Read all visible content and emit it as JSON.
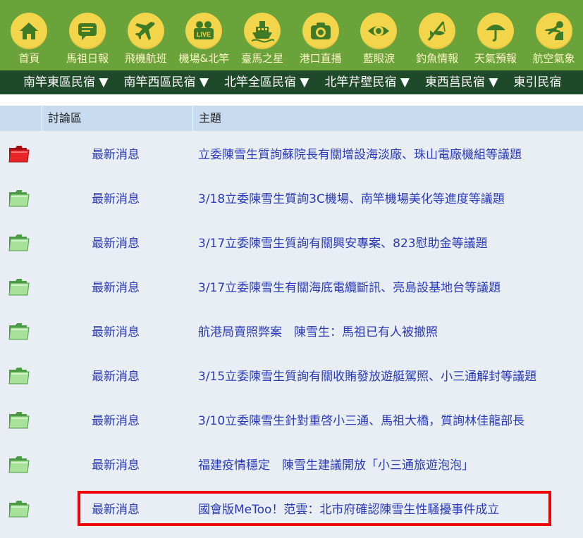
{
  "top_nav": [
    {
      "label": "首頁",
      "icon": "home-icon"
    },
    {
      "label": "馬祖日報",
      "icon": "speech-bubble-icon"
    },
    {
      "label": "飛機航班",
      "icon": "airplane-icon"
    },
    {
      "label": "機場&北竿",
      "icon": "live-camera-icon"
    },
    {
      "label": "臺馬之星",
      "icon": "ship-icon"
    },
    {
      "label": "港口直播",
      "icon": "camera-icon"
    },
    {
      "label": "藍眼淚",
      "icon": "eye-icon"
    },
    {
      "label": "釣魚情報",
      "icon": "fishing-icon"
    },
    {
      "label": "天氣預報",
      "icon": "umbrella-icon"
    },
    {
      "label": "航空氣象",
      "icon": "plane-weather-icon"
    }
  ],
  "sub_nav": [
    "南竿東區民宿 ▼",
    "南竿西區民宿 ▼",
    "北竿全區民宿 ▼",
    "北竿芹壁民宿 ▼",
    "東西莒民宿 ▼",
    "東引民宿"
  ],
  "table": {
    "headers": {
      "forum": "討論區",
      "topic": "主題"
    },
    "rows": [
      {
        "folder": "red",
        "forum": "最新消息",
        "topic": "立委陳雪生質詢蘇院長有關增設海淡廠、珠山電廠機組等議題"
      },
      {
        "folder": "green",
        "forum": "最新消息",
        "topic": "3/18立委陳雪生質詢3C機場、南竿機場美化等進度等議題"
      },
      {
        "folder": "green",
        "forum": "最新消息",
        "topic": "3/17立委陳雪生質詢有關興安專案、823慰助金等議題"
      },
      {
        "folder": "green",
        "forum": "最新消息",
        "topic": "3/17立委陳雪生有關海底電纜斷訊、亮島設基地台等議題"
      },
      {
        "folder": "green",
        "forum": "最新消息",
        "topic": "航港局賣照弊案　陳雪生：馬祖已有人被撤照"
      },
      {
        "folder": "green",
        "forum": "最新消息",
        "topic": "3/15立委陳雪生質詢有關收賄發放遊艇駕照、小三通解封等議題"
      },
      {
        "folder": "green",
        "forum": "最新消息",
        "topic": "3/10立委陳雪生針對重啓小三通、馬祖大橋，質詢林佳龍部長"
      },
      {
        "folder": "green",
        "forum": "最新消息",
        "topic": "福建疫情穩定　陳雪生建議開放「小三通旅遊泡泡」"
      },
      {
        "folder": "green",
        "forum": "最新消息",
        "topic": "國會版MeToo！范雲：北市府確認陳雪生性騷擾事件成立"
      }
    ]
  },
  "colors": {
    "nav_bg": "#6aa33a",
    "icon_bg": "#f2d54a",
    "subnav_bg": "#1f4a2a",
    "header_bg": "#c8dbef",
    "row_bg": "#e8eef3",
    "link": "#2a3ab8",
    "highlight": "#f00000"
  }
}
